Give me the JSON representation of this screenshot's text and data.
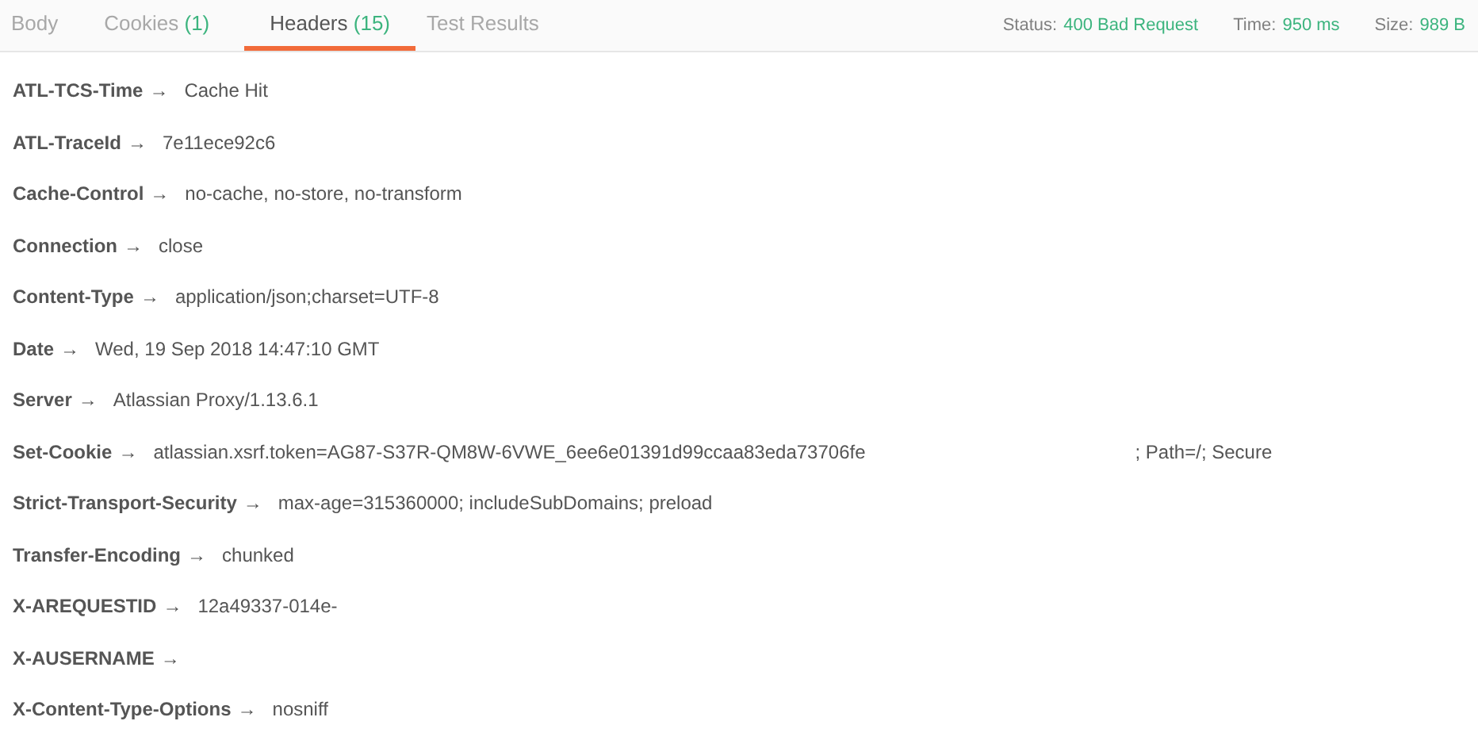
{
  "tabs": [
    {
      "label": "Body",
      "selected": false
    },
    {
      "label": "Cookies",
      "count": "(1)",
      "selected": false
    },
    {
      "label": "Headers",
      "count": "(15)",
      "selected": true
    },
    {
      "label": "Test Results",
      "selected": false
    }
  ],
  "status": [
    {
      "label": "Status:",
      "value": "400 Bad Request"
    },
    {
      "label": "Time:",
      "value": "950 ms"
    },
    {
      "label": "Size:",
      "value": "989 B"
    }
  ],
  "headers": [
    {
      "name": "ATL-TCS-Time",
      "arrow": "→",
      "value": "Cache Hit"
    },
    {
      "name": "ATL-TraceId",
      "arrow": "→",
      "value": "7e11ece92c6"
    },
    {
      "name": "Cache-Control",
      "arrow": "→",
      "value": "no-cache, no-store, no-transform"
    },
    {
      "name": "Connection",
      "arrow": "→",
      "value": "close"
    },
    {
      "name": "Content-Type",
      "arrow": "→",
      "value": "application/json;charset=UTF-8"
    },
    {
      "name": "Date",
      "arrow": "→",
      "value": "Wed, 19 Sep 2018 14:47:10 GMT"
    },
    {
      "name": "Server",
      "arrow": "→",
      "value": "Atlassian Proxy/1.13.6.1"
    },
    {
      "name": "Set-Cookie",
      "arrow": "→",
      "value": "atlassian.xsrf.token=AG87-S37R-QM8W-6VWE_6ee6e01391d99ccaa83eda73706fe",
      "value_after_gap": "; Path=/; Secure"
    },
    {
      "name": "Strict-Transport-Security",
      "arrow": "→",
      "value": "max-age=315360000; includeSubDomains; preload"
    },
    {
      "name": "Transfer-Encoding",
      "arrow": "→",
      "value": "chunked"
    },
    {
      "name": "X-AREQUESTID",
      "arrow": "→",
      "value": "12a49337-014e-"
    },
    {
      "name": "X-AUSERNAME",
      "arrow": "→"
    },
    {
      "name": "X-Content-Type-Options",
      "arrow": "→",
      "value": "nosniff"
    }
  ]
}
